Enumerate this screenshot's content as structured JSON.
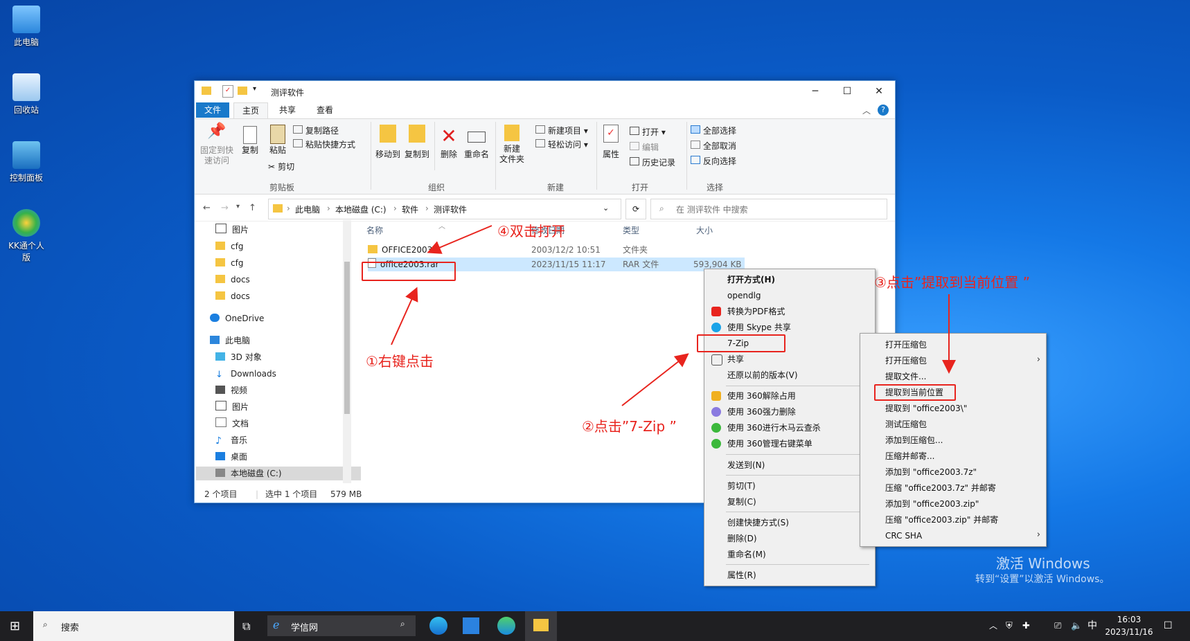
{
  "desktop": {
    "icons": [
      {
        "label": "此电脑"
      },
      {
        "label": "回收站"
      },
      {
        "label": "控制面板"
      },
      {
        "label": "KK通个人版"
      }
    ]
  },
  "window": {
    "title": "测评软件",
    "tabs": [
      "文件",
      "主页",
      "共享",
      "查看"
    ],
    "ribbon": {
      "pin_label": "固定到快",
      "pin_label2": "速访问",
      "copy": "复制",
      "paste": "粘贴",
      "copy_path": "复制路径",
      "paste_shortcut": "粘贴快捷方式",
      "cut": "剪切",
      "group_clipboard": "剪贴板",
      "move_to": "移动到",
      "copy_to": "复制到",
      "delete": "删除",
      "rename": "重命名",
      "group_organize": "组织",
      "new_folder": "新建",
      "new_folder2": "文件夹",
      "new_item": "新建项目",
      "easy_access": "轻松访问",
      "group_new": "新建",
      "properties": "属性",
      "open": "打开",
      "edit": "编辑",
      "history": "历史记录",
      "group_open": "打开",
      "select_all": "全部选择",
      "select_none": "全部取消",
      "invert": "反向选择",
      "group_select": "选择"
    },
    "breadcrumb": [
      "此电脑",
      "本地磁盘 (C:)",
      "软件",
      "测评软件"
    ],
    "search_placeholder": "在 测评软件 中搜索",
    "nav_items": [
      {
        "label": "图片",
        "icon": "pictures-icon"
      },
      {
        "label": "cfg",
        "icon": "folder-icon"
      },
      {
        "label": "cfg",
        "icon": "folder-icon"
      },
      {
        "label": "docs",
        "icon": "folder-icon"
      },
      {
        "label": "docs",
        "icon": "folder-icon"
      },
      {
        "label": "OneDrive",
        "icon": "cloud-icon"
      },
      {
        "label": "此电脑",
        "icon": "computer-icon"
      },
      {
        "label": "3D 对象",
        "icon": "cube-icon"
      },
      {
        "label": "Downloads",
        "icon": "download-icon"
      },
      {
        "label": "视频",
        "icon": "video-icon"
      },
      {
        "label": "图片",
        "icon": "pictures-icon"
      },
      {
        "label": "文档",
        "icon": "document-icon"
      },
      {
        "label": "音乐",
        "icon": "music-icon"
      },
      {
        "label": "桌面",
        "icon": "desktop-icon"
      },
      {
        "label": "本地磁盘 (C:)",
        "icon": "drive-icon"
      }
    ],
    "columns": [
      "名称",
      "修改日期",
      "类型",
      "大小"
    ],
    "files": [
      {
        "name": "OFFICE2003",
        "date": "2003/12/2 10:51",
        "type": "文件夹",
        "size": ""
      },
      {
        "name": "office2003.rar",
        "date": "2023/11/15 11:17",
        "type": "RAR 文件",
        "size": "593,904 KB"
      }
    ],
    "status": {
      "count": "2 个项目",
      "selected": "选中 1 个项目",
      "size": "579 MB"
    }
  },
  "context_menu": {
    "items": [
      "打开方式(H)",
      "opendlg",
      "转换为PDF格式",
      "使用 Skype 共享",
      "7-Zip",
      "共享",
      "还原以前的版本(V)",
      "使用 360解除占用",
      "使用 360强力删除",
      "使用 360进行木马云查杀",
      "使用 360管理右键菜单",
      "发送到(N)",
      "剪切(T)",
      "复制(C)",
      "创建快捷方式(S)",
      "删除(D)",
      "重命名(M)",
      "属性(R)"
    ]
  },
  "submenu_7zip": {
    "items": [
      "打开压缩包",
      "打开压缩包",
      "提取文件...",
      "提取到当前位置",
      "提取到 \"office2003\\\"",
      "测试压缩包",
      "添加到压缩包...",
      "压缩并邮寄...",
      "添加到 \"office2003.7z\"",
      "压缩 \"office2003.7z\" 并邮寄",
      "添加到 \"office2003.zip\"",
      "压缩 \"office2003.zip\" 并邮寄",
      "CRC SHA"
    ]
  },
  "annotations": {
    "step1": "①右键点击",
    "step2": "②点击”7-Zip ”",
    "step3": "③点击”提取到当前位置 ”",
    "step4": "④双击打开"
  },
  "watermark": {
    "line1": "激活 Windows",
    "line2": "转到“设置”以激活 Windows。"
  },
  "taskbar": {
    "search": "搜索",
    "app_name": "学信网",
    "ime": "中",
    "time": "16:03",
    "date": "2023/11/16"
  },
  "colors": {
    "accent": "#1979ca",
    "annotation": "#e8241e",
    "selection": "#cce8ff"
  }
}
